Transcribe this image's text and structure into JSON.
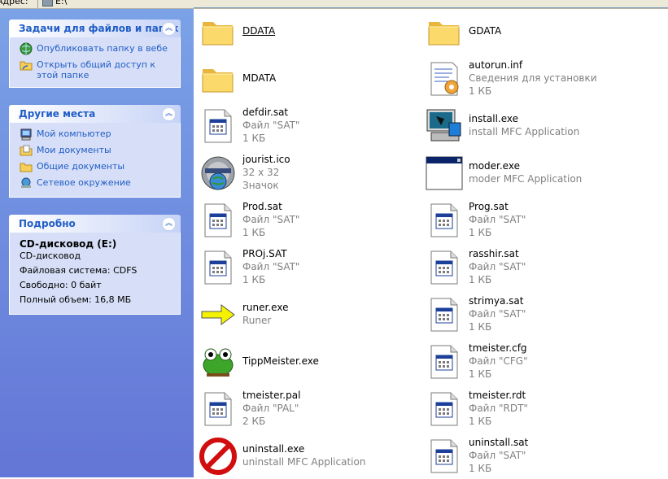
{
  "topbar": {
    "label": "Адрес:",
    "address": "E:\\"
  },
  "tasks": {
    "title": "Задачи для файлов и папок",
    "items": [
      {
        "label": "Опубликовать папку в вебе",
        "icon": "globe-icon"
      },
      {
        "label": "Открыть общий доступ к этой папке",
        "icon": "share-folder-icon"
      }
    ]
  },
  "places": {
    "title": "Другие места",
    "items": [
      {
        "label": "Мой компьютер",
        "icon": "computer-icon"
      },
      {
        "label": "Мои документы",
        "icon": "documents-icon"
      },
      {
        "label": "Общие документы",
        "icon": "folder-icon"
      },
      {
        "label": "Сетевое окружение",
        "icon": "network-icon"
      }
    ]
  },
  "details": {
    "title": "Подробно",
    "name": "CD-дисковод (E:)",
    "type": "CD-дисковод",
    "fs": "Файловая система: CDFS",
    "free": "Свободно: 0 байт",
    "total": "Полный объем: 16,8 МБ"
  },
  "files": [
    {
      "name": "DDATA",
      "l2": "",
      "l3": "",
      "icon": "folder-icon"
    },
    {
      "name": "GDATA",
      "l2": "",
      "l3": "",
      "icon": "folder-icon"
    },
    {
      "name": "MDATA",
      "l2": "",
      "l3": "",
      "icon": "folder-icon"
    },
    {
      "name": "autorun.inf",
      "l2": "Сведения для установки",
      "l3": "1 КБ",
      "icon": "setup-info-icon"
    },
    {
      "name": "defdir.sat",
      "l2": "Файл \"SAT\"",
      "l3": "1 КБ",
      "icon": "generic-file-icon"
    },
    {
      "name": "install.exe",
      "l2": "install MFC Application",
      "l3": "",
      "icon": "installer-icon"
    },
    {
      "name": "jourist.ico",
      "l2": "32 x 32",
      "l3": "Значок",
      "icon": "jourist-icon"
    },
    {
      "name": "moder.exe",
      "l2": "moder MFC Application",
      "l3": "",
      "icon": "window-app-icon"
    },
    {
      "name": "Prod.sat",
      "l2": "Файл \"SAT\"",
      "l3": "1 КБ",
      "icon": "generic-file-icon"
    },
    {
      "name": "Prog.sat",
      "l2": "Файл \"SAT\"",
      "l3": "1 КБ",
      "icon": "generic-file-icon"
    },
    {
      "name": "PROj.SAT",
      "l2": "Файл \"SAT\"",
      "l3": "1 КБ",
      "icon": "generic-file-icon"
    },
    {
      "name": "rasshir.sat",
      "l2": "Файл \"SAT\"",
      "l3": "1 КБ",
      "icon": "generic-file-icon"
    },
    {
      "name": "runer.exe",
      "l2": "Runer",
      "l3": "",
      "icon": "arrow-icon"
    },
    {
      "name": "strimya.sat",
      "l2": "Файл \"SAT\"",
      "l3": "1 КБ",
      "icon": "generic-file-icon"
    },
    {
      "name": "TippMeister.exe",
      "l2": "",
      "l3": "",
      "icon": "frog-icon"
    },
    {
      "name": "tmeister.cfg",
      "l2": "Файл \"CFG\"",
      "l3": "1 КБ",
      "icon": "generic-file-icon"
    },
    {
      "name": "tmeister.pal",
      "l2": "Файл \"PAL\"",
      "l3": "2 КБ",
      "icon": "generic-file-icon"
    },
    {
      "name": "tmeister.rdt",
      "l2": "Файл \"RDT\"",
      "l3": "1 КБ",
      "icon": "generic-file-icon"
    },
    {
      "name": "uninstall.exe",
      "l2": "uninstall MFC Application",
      "l3": "",
      "icon": "no-entry-icon"
    },
    {
      "name": "uninstall.sat",
      "l2": "Файл \"SAT\"",
      "l3": "1 КБ",
      "icon": "generic-file-icon"
    }
  ]
}
